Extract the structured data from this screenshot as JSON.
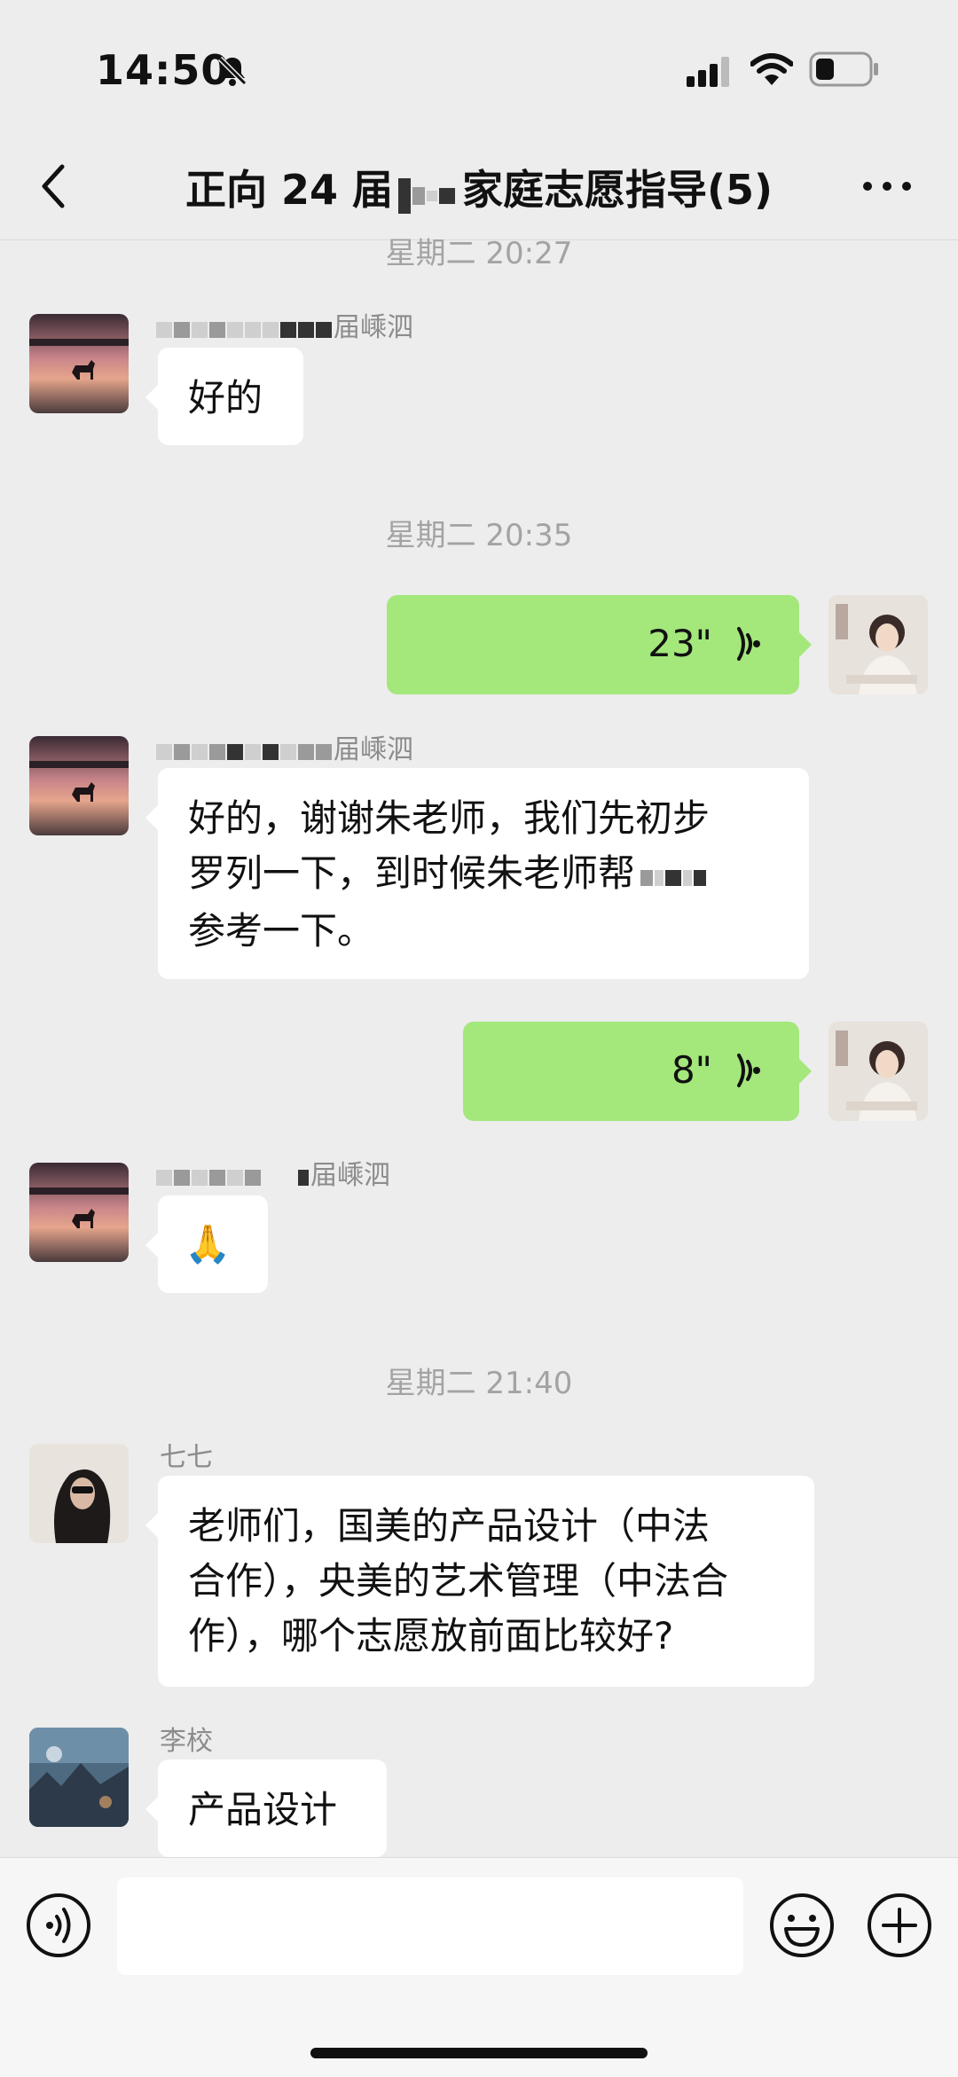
{
  "status_bar": {
    "time": "14:50"
  },
  "header": {
    "title_start": "正向 24 届",
    "title_end": "家庭志愿指导(5)"
  },
  "messages": {
    "ts1": "星期二 20:27",
    "m1_sender_suffix": "届嵊泗",
    "m1_text": "好的",
    "ts2": "星期二 20:35",
    "m2_voice_duration": "23\"",
    "m3_sender_suffix": "届嵊泗",
    "m3_line1": "好的，谢谢朱老师，我们先初步",
    "m3_line2": "罗列一下，到时候朱老师帮",
    "m3_line3": "参考一下。",
    "m4_voice_duration": "8\"",
    "m5_sender_suffix": "届嵊泗",
    "m5_emoji": "🙏",
    "ts3": "星期二 21:40",
    "m6_sender": "七七",
    "m6_line1": "老师们，国美的产品设计（中法",
    "m6_line2": "合作），央美的艺术管理（中法合",
    "m6_line3": "作），哪个志愿放前面比较好?",
    "m7_sender": "李校",
    "m7_text": "产品设计"
  },
  "colors": {
    "background": "#ededed",
    "outgoing_bubble": "#a4e77b",
    "incoming_bubble": "#ffffff",
    "meta_text": "#a3a3a3"
  },
  "icons": [
    "bell-slash-icon",
    "signal-icon",
    "wifi-icon",
    "battery-icon",
    "back-chevron-icon",
    "more-dots-icon",
    "voice-wave-icon",
    "voice-input-icon",
    "emoji-icon",
    "plus-icon"
  ]
}
